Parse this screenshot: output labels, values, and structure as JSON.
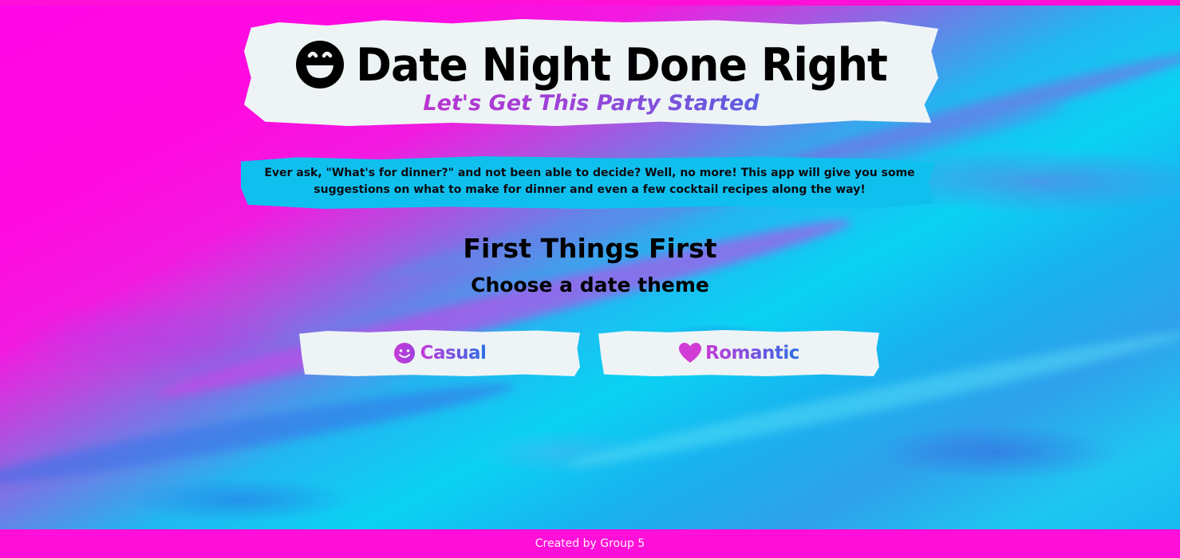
{
  "header": {
    "title": "Date Night Done Right",
    "subtitle": "Let's Get This Party Started",
    "icon": "grinning-face-icon"
  },
  "intro": {
    "text": "Ever ask, \"What's for dinner?\" and not been able to decide? Well, no more! This app will give you some suggestions on what to make for dinner and even a few cocktail recipes along the way!"
  },
  "theme_section": {
    "title": "First Things First",
    "subtitle": "Choose a date theme",
    "options": [
      {
        "label": "Casual",
        "icon": "smiley-face-icon"
      },
      {
        "label": "Romantic",
        "icon": "heart-icon"
      }
    ]
  },
  "footer": {
    "text": "Created by Group 5"
  },
  "colors": {
    "background_pink": "#ff0fd8",
    "accent_cyan": "#0fc0ee",
    "brush_white": "#eef4f6",
    "label_gradient_start": "#c63ad8",
    "label_gradient_end": "#2b6fe6"
  }
}
